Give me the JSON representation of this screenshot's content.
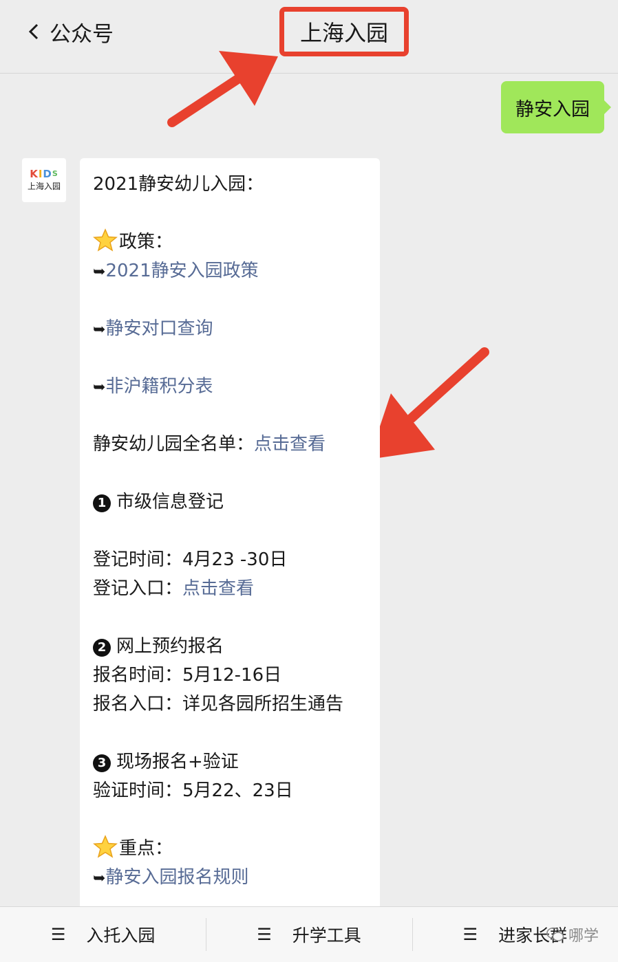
{
  "header": {
    "back_label": "公众号",
    "title": "上海入园",
    "highlight_color": "#e8412e"
  },
  "outgoing_message": "静安入园",
  "account": {
    "avatar_logo": "KIDS",
    "avatar_sub": "上海入园"
  },
  "message": {
    "heading": "2021静安幼儿入园：",
    "policy_label": "政策：",
    "links": {
      "policy": "2021静安入园政策",
      "lookup": "静安对口查询",
      "points": "非沪籍积分表"
    },
    "fulllist_label": "静安幼儿园全名单：",
    "fulllist_link": "点击查看",
    "step1": {
      "num": "1",
      "title": "市级信息登记",
      "time_label": "登记时间：",
      "time": "4月23 -30日",
      "entry_label": "登记入口：",
      "entry_link": "点击查看"
    },
    "step2": {
      "num": "2",
      "title": "网上预约报名",
      "time_label": "报名时间：",
      "time": "5月12-16日",
      "entry_label": "报名入口：",
      "entry": "详见各园所招生通告"
    },
    "step3": {
      "num": "3",
      "title": "现场报名+验证",
      "time_label": "验证时间：",
      "time": "5月22、23日"
    },
    "key_label": "重点：",
    "key_link": "静安入园报名规则"
  },
  "bottom_menu": [
    "入托入园",
    "升学工具",
    "进家长群"
  ],
  "watermark": "哪学",
  "colors": {
    "link": "#576b95",
    "outgoing_bubble": "#a0e75a",
    "background": "#ededed"
  }
}
